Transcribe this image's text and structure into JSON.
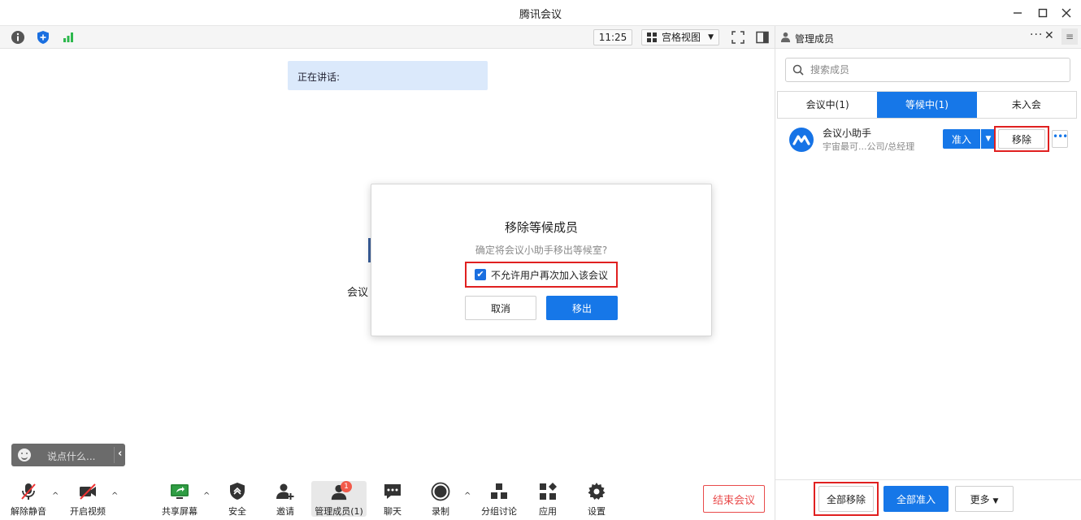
{
  "window": {
    "title": "腾讯会议"
  },
  "toolbar": {
    "time": "11:25",
    "view_label": "宫格视图"
  },
  "main": {
    "speaking_label": "正在讲话:",
    "behind_text": "会议",
    "chat_placeholder": "说点什么..."
  },
  "dialog": {
    "title": "移除等候成员",
    "description": "确定将会议小助手移出等候室?",
    "checkbox_label": "不允许用户再次加入该会议",
    "checkbox_checked": true,
    "cancel_label": "取消",
    "confirm_label": "移出"
  },
  "bottom": {
    "items": [
      {
        "label": "解除静音"
      },
      {
        "label": "开启视频"
      },
      {
        "label": "共享屏幕"
      },
      {
        "label": "安全"
      },
      {
        "label": "邀请"
      },
      {
        "label": "管理成员(1)",
        "badge": "1"
      },
      {
        "label": "聊天"
      },
      {
        "label": "录制"
      },
      {
        "label": "分组讨论"
      },
      {
        "label": "应用"
      },
      {
        "label": "设置"
      }
    ],
    "end_label": "结束会议"
  },
  "panel": {
    "title": "管理成员",
    "search_placeholder": "搜索成员",
    "tabs": [
      {
        "label": "会议中(1)"
      },
      {
        "label": "等候中(1)",
        "active": true
      },
      {
        "label": "未入会"
      }
    ],
    "member": {
      "name": "会议小助手",
      "subtitle": "宇宙最可...公司/总经理",
      "admit_label": "准入",
      "remove_label": "移除"
    },
    "footer": {
      "remove_all_label": "全部移除",
      "admit_all_label": "全部准入",
      "more_label": "更多"
    }
  },
  "colors": {
    "accent": "#1677e8",
    "highlight": "#e02020",
    "end_red": "#e94b4b",
    "badge": "#f25a4a"
  }
}
